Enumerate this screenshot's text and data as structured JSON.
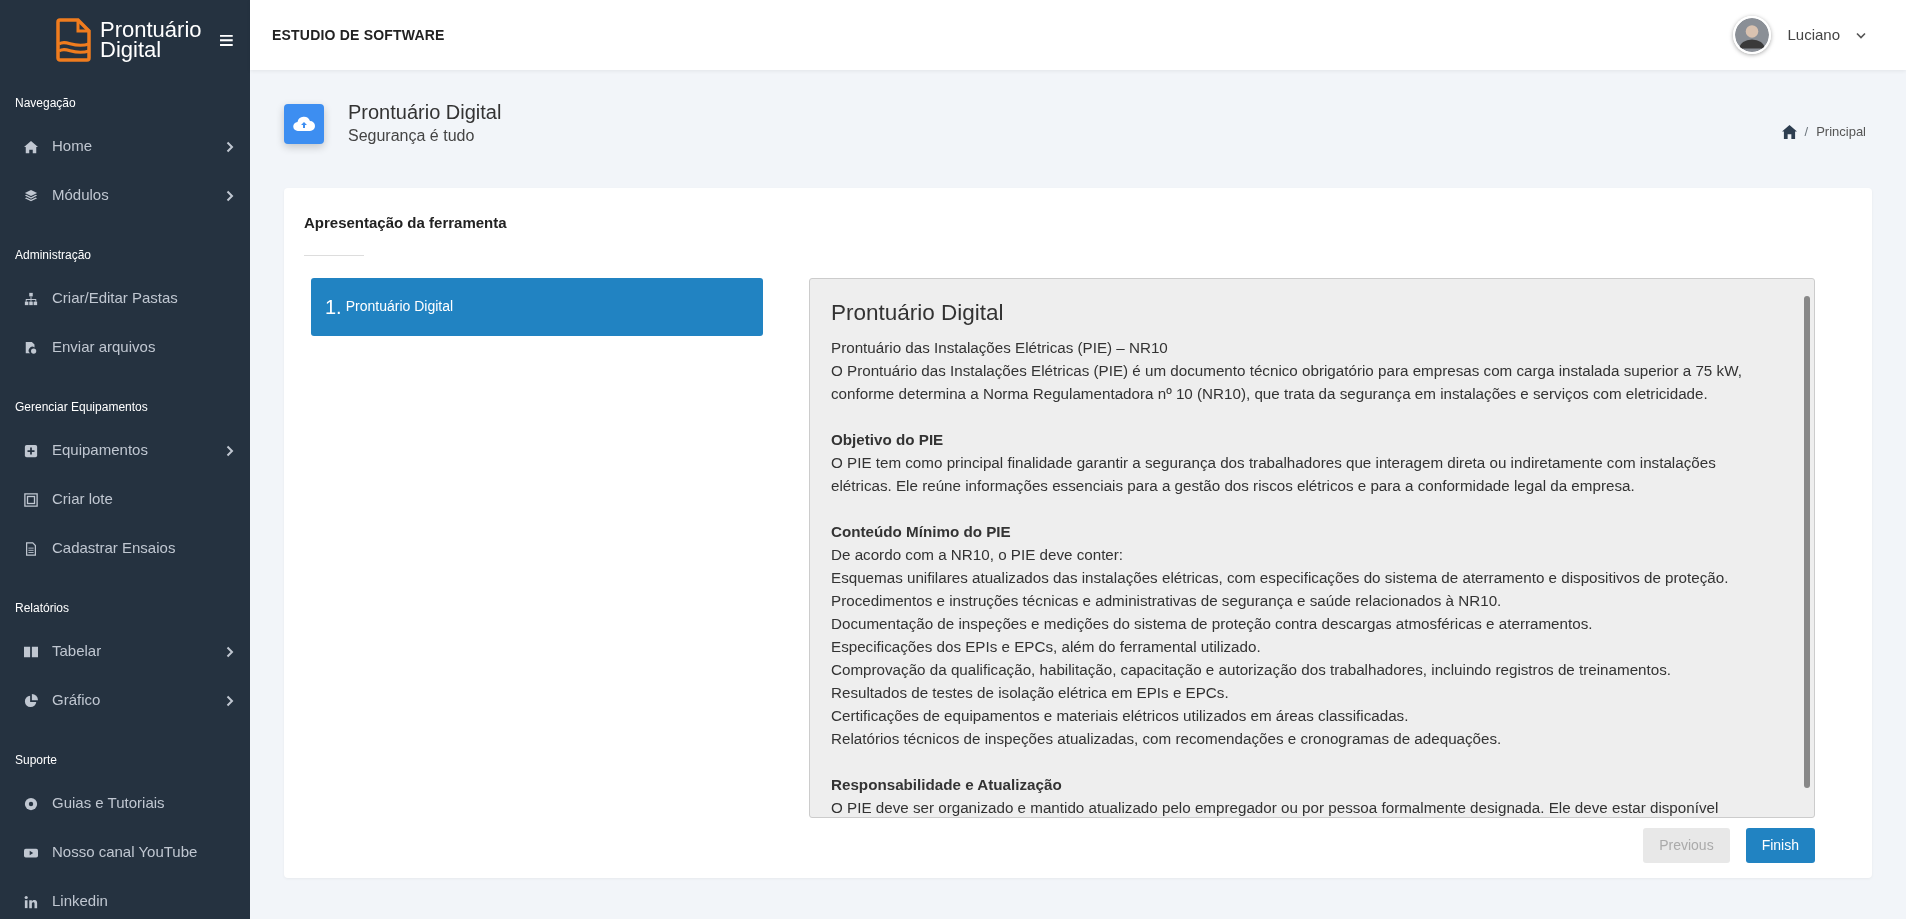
{
  "brand": {
    "line1": "Prontuário",
    "line2": "Digital",
    "menu_glyph": "≡"
  },
  "sidebar": {
    "groups": [
      {
        "label": "Navegação",
        "items": [
          {
            "label": "Home",
            "has_submenu": true
          },
          {
            "label": "Módulos",
            "has_submenu": true
          }
        ]
      },
      {
        "label": "Administração",
        "items": [
          {
            "label": "Criar/Editar Pastas",
            "has_submenu": false
          },
          {
            "label": "Enviar arquivos",
            "has_submenu": false
          }
        ]
      },
      {
        "label": "Gerenciar Equipamentos",
        "items": [
          {
            "label": "Equipamentos",
            "has_submenu": true
          },
          {
            "label": "Criar lote",
            "has_submenu": false
          },
          {
            "label": "Cadastrar Ensaios",
            "has_submenu": false
          }
        ]
      },
      {
        "label": "Relatórios",
        "items": [
          {
            "label": "Tabelar",
            "has_submenu": true
          },
          {
            "label": "Gráfico",
            "has_submenu": true
          }
        ]
      },
      {
        "label": "Suporte",
        "items": [
          {
            "label": "Guias e Tutoriais",
            "has_submenu": false
          },
          {
            "label": "Nosso canal YouTube",
            "has_submenu": false
          },
          {
            "label": "Linkedin",
            "has_submenu": false
          }
        ]
      }
    ]
  },
  "header": {
    "company": "ESTUDIO DE SOFTWARE",
    "user": "Luciano"
  },
  "page": {
    "title": "Prontuário Digital",
    "subtitle": "Segurança é tudo",
    "breadcrumb": [
      "Principal"
    ],
    "separator": "/"
  },
  "card": {
    "title": "Apresentação da ferramenta",
    "steps": [
      {
        "number": "1.",
        "label": "Prontuário Digital",
        "selected": true
      }
    ],
    "content": {
      "title": "Prontuário Digital",
      "intro": [
        "Prontuário das Instalações Elétricas (PIE) – NR10",
        "O Prontuário das Instalações Elétricas (PIE) é um documento técnico obrigatório para empresas com carga instalada superior a 75 kW, conforme determina a Norma Regulamentadora nº 10 (NR10), que trata da segurança em instalações e serviços com eletricidade."
      ],
      "sections": [
        {
          "heading": "Objetivo do PIE",
          "lines": [
            "O PIE tem como principal finalidade garantir a segurança dos trabalhadores que interagem direta ou indiretamente com instalações elétricas. Ele reúne informações essenciais para a gestão dos riscos elétricos e para a conformidade legal da empresa."
          ]
        },
        {
          "heading": "Conteúdo Mínimo do PIE",
          "lines": [
            "De acordo com a NR10, o PIE deve conter:",
            "Esquemas unifilares atualizados das instalações elétricas, com especificações do sistema de aterramento e dispositivos de proteção.",
            "Procedimentos e instruções técnicas e administrativas de segurança e saúde relacionados à NR10.",
            "Documentação de inspeções e medições do sistema de proteção contra descargas atmosféricas e aterramentos.",
            "Especificações dos EPIs e EPCs, além do ferramental utilizado.",
            "Comprovação da qualificação, habilitação, capacitação e autorização dos trabalhadores, incluindo registros de treinamentos.",
            "Resultados de testes de isolação elétrica em EPIs e EPCs.",
            "Certificações de equipamentos e materiais elétricos utilizados em áreas classificadas.",
            "Relatórios técnicos de inspeções atualizadas, com recomendações e cronogramas de adequações."
          ]
        },
        {
          "heading": "Responsabilidade e Atualização",
          "lines": [
            "O PIE deve ser organizado e mantido atualizado pelo empregador ou por pessoa formalmente designada. Ele deve estar disponível"
          ]
        }
      ]
    },
    "buttons": [
      {
        "label": "Previous",
        "kind": "secondary",
        "disabled": true
      },
      {
        "label": "Finish",
        "kind": "primary",
        "disabled": false
      }
    ]
  }
}
